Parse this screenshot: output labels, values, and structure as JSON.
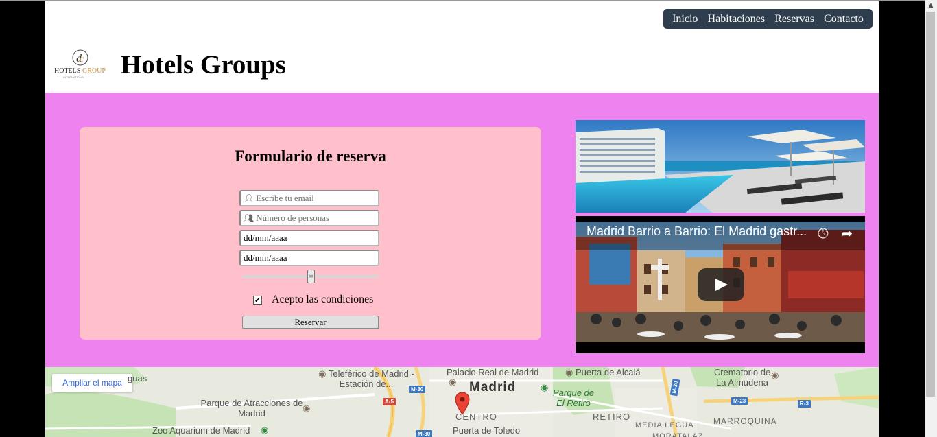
{
  "header": {
    "nav": [
      "Inicio",
      "Habitaciones",
      "Reservas",
      "Contacto"
    ],
    "title": "Hotels Groups",
    "logo_text": "HOTELS GROUP",
    "logo_sub": "INTERNATIONAL"
  },
  "form": {
    "title": "Formulario de reserva",
    "email_placeholder": "Escribe tu email",
    "persons_placeholder": "Número de personas",
    "date_in": "dd/mm/aaaa",
    "date_out": "dd/mm/aaaa",
    "slider_value": 0.5,
    "accept_label": "Acepto las condiciones",
    "accept_checked": true,
    "submit_label": "Reservar"
  },
  "video": {
    "title": "Madrid Barrio a Barrio: El Madrid gastr..."
  },
  "map": {
    "enlarge_label": "Ampliar el mapa",
    "labels": {
      "teleferico": "Teleférico de Madrid - Estación de...",
      "palacio": "Palacio Real de Madrid",
      "puerta_alcala": "Puerta de Alcalá",
      "crematorio": "Crematorio de La Almudena",
      "madrid": "Madrid",
      "parque_atracciones": "Parque de Atracciones de Madrid",
      "parque_retiro": "Parque de El Retiro",
      "centro": "CENTRO",
      "retiro": "RETIRO",
      "marroquina": "MARROQUINA",
      "zoo": "Zoo Aquarium de Madrid",
      "puerta_toledo": "Puerta de Toledo",
      "media_legua": "MEDIA LEGUA",
      "moratalaz": "MORATALAZ",
      "aguas": "guas",
      "m30_a": "M-30",
      "m30_b": "M-30",
      "m30_c": "M-30",
      "a5": "A-5",
      "m23": "M-23",
      "r3": "R-3",
      "m30_lat": "M-30"
    }
  },
  "colors": {
    "band": "#ee82ee",
    "form_card": "#ffc0cb",
    "nav_bg": "#2f3e4f",
    "map_link": "#3367d6"
  }
}
